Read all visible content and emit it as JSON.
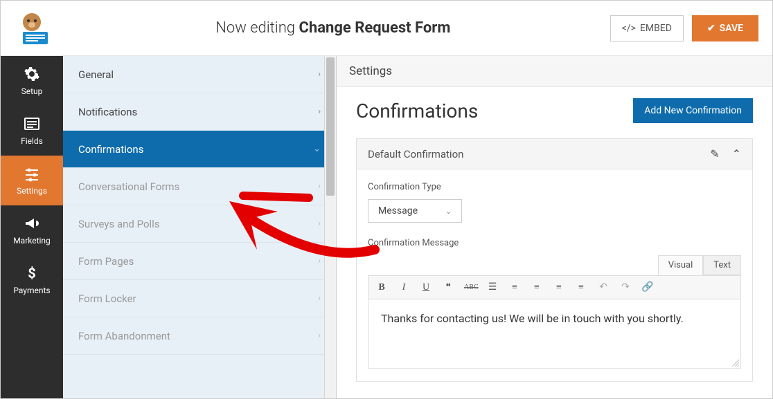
{
  "header": {
    "editing_prefix": "Now editing",
    "form_name": "Change Request Form",
    "embed_label": "EMBED",
    "save_label": "SAVE"
  },
  "left_nav": [
    {
      "label": "Setup",
      "icon": "gear"
    },
    {
      "label": "Fields",
      "icon": "list"
    },
    {
      "label": "Settings",
      "icon": "sliders",
      "active": true
    },
    {
      "label": "Marketing",
      "icon": "bullhorn"
    },
    {
      "label": "Payments",
      "icon": "dollar"
    }
  ],
  "sub_sidebar": [
    {
      "label": "General",
      "active": false,
      "muted": false
    },
    {
      "label": "Notifications",
      "active": false,
      "muted": false
    },
    {
      "label": "Confirmations",
      "active": true,
      "muted": false
    },
    {
      "label": "Conversational Forms",
      "active": false,
      "muted": true
    },
    {
      "label": "Surveys and Polls",
      "active": false,
      "muted": true
    },
    {
      "label": "Form Pages",
      "active": false,
      "muted": true
    },
    {
      "label": "Form Locker",
      "active": false,
      "muted": true
    },
    {
      "label": "Form Abandonment",
      "active": false,
      "muted": true
    }
  ],
  "content": {
    "section_header": "Settings",
    "page_title": "Confirmations",
    "add_button": "Add New Confirmation",
    "panel_title": "Default Confirmation",
    "confirmation_type_label": "Confirmation Type",
    "confirmation_type_value": "Message",
    "confirmation_message_label": "Confirmation Message",
    "editor_tabs": {
      "visual": "Visual",
      "text": "Text"
    },
    "message_body": "Thanks for contacting us! We will be in touch with you shortly."
  },
  "colors": {
    "accent_orange": "#e27730",
    "accent_blue": "#0e6cad",
    "arrow_red": "#e30000"
  }
}
